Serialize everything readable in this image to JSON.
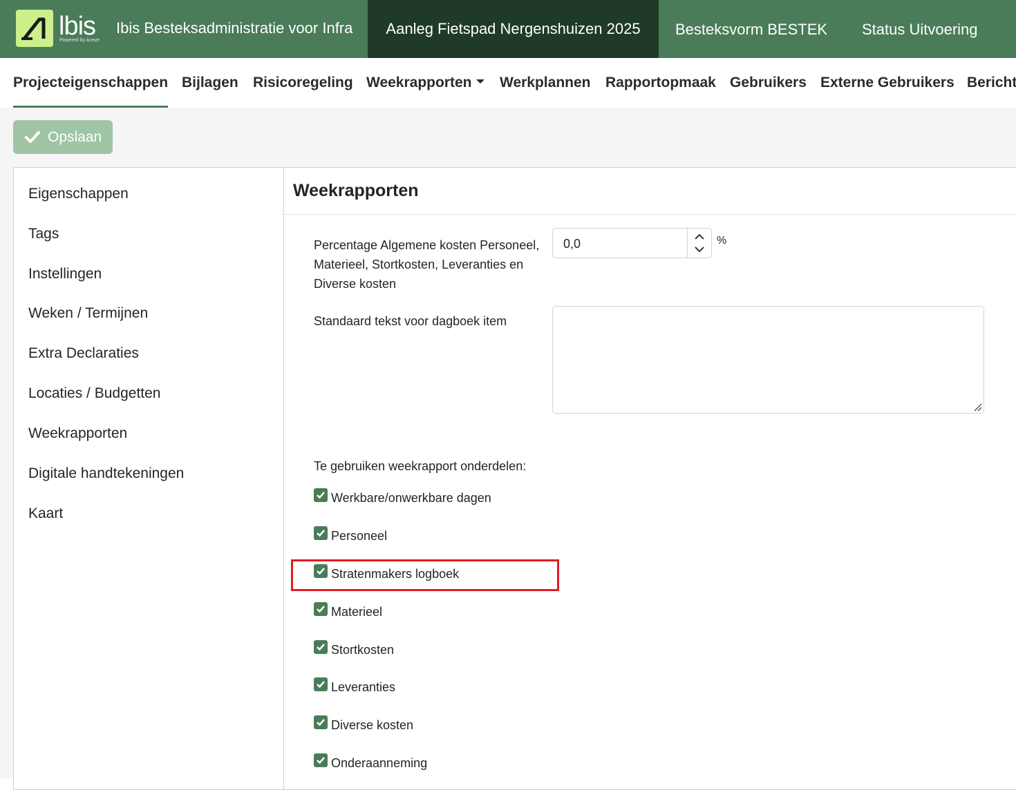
{
  "header": {
    "brand": "lbis",
    "brand_sub": "Powered by Aceve",
    "app_title": "Ibis Besteksadministratie voor Infra",
    "project": "Aanleg Fietspad Nergenshuizen 2025",
    "bestek": "Besteksvorm BESTEK",
    "status": "Status Uitvoering"
  },
  "tabs": [
    {
      "label": "Projecteigenschappen",
      "active": true
    },
    {
      "label": "Bijlagen"
    },
    {
      "label": "Risicoregeling"
    },
    {
      "label": "Weekrapporten",
      "dropdown": true
    },
    {
      "label": "Werkplannen"
    },
    {
      "label": "Rapportopmaak"
    },
    {
      "label": "Gebruikers"
    },
    {
      "label": "Externe Gebruikers"
    },
    {
      "label": "Bericht"
    }
  ],
  "toolbar": {
    "save_label": "Opslaan"
  },
  "sidebar": {
    "items": [
      {
        "label": "Eigenschappen"
      },
      {
        "label": "Tags"
      },
      {
        "label": "Instellingen"
      },
      {
        "label": "Weken / Termijnen"
      },
      {
        "label": "Extra Declaraties"
      },
      {
        "label": "Locaties / Budgetten"
      },
      {
        "label": "Weekrapporten"
      },
      {
        "label": "Digitale handtekeningen"
      },
      {
        "label": "Kaart"
      }
    ]
  },
  "main": {
    "title": "Weekrapporten",
    "percentage": {
      "label": "Percentage Algemene kosten Personeel, Materieel, Stortkosten, Leveranties en Diverse kosten",
      "value": "0,0",
      "unit": "%"
    },
    "standard_text": {
      "label": "Standaard tekst voor dagboek item",
      "value": ""
    },
    "parts_label": "Te gebruiken weekrapport onderdelen:",
    "parts": [
      {
        "label": "Werkbare/onwerkbare dagen",
        "checked": true
      },
      {
        "label": "Personeel",
        "checked": true
      },
      {
        "label": "Stratenmakers logboek",
        "checked": true,
        "highlighted": true
      },
      {
        "label": "Materieel",
        "checked": true
      },
      {
        "label": "Stortkosten",
        "checked": true
      },
      {
        "label": "Leveranties",
        "checked": true
      },
      {
        "label": "Diverse kosten",
        "checked": true
      },
      {
        "label": "Onderaanneming",
        "checked": true
      }
    ]
  },
  "colors": {
    "topbar": "#4a7c59",
    "project_bg": "#1f3b27",
    "accent": "#4a7c59",
    "save_button": "#9fc4a6",
    "highlight": "#e11b22",
    "logo_bg": "#ccf08c"
  }
}
